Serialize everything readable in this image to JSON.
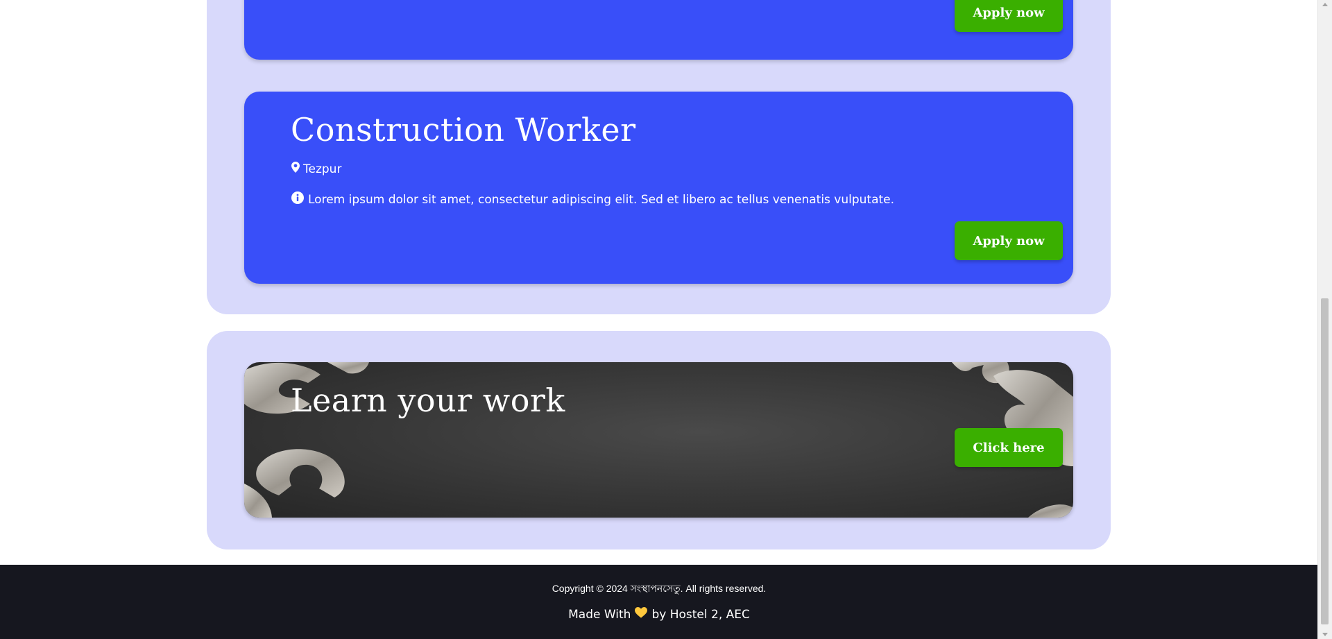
{
  "jobs": {
    "previous": {
      "apply_label": "Apply now"
    },
    "current": {
      "title": "Construction Worker",
      "location": "Tezpur",
      "description": "Lorem ipsum dolor sit amet, consectetur adipiscing elit. Sed et libero ac tellus venenatis vulputate.",
      "apply_label": "Apply now"
    }
  },
  "learn": {
    "title": "Learn your work",
    "button_label": "Click here"
  },
  "footer": {
    "copyright": "Copyright © 2024 সংস্থাপনসেতু. All rights reserved.",
    "made_with_prefix": "Made With",
    "made_with_suffix": "by Hostel 2, AEC"
  },
  "colors": {
    "section_bg": "#d8d9fb",
    "card_bg": "#394ff9",
    "button_green": "#3aaf00",
    "footer_bg": "#16171f"
  },
  "icons": {
    "location": "map-marker-icon",
    "info": "info-circle-icon",
    "heart": "heart-icon"
  }
}
